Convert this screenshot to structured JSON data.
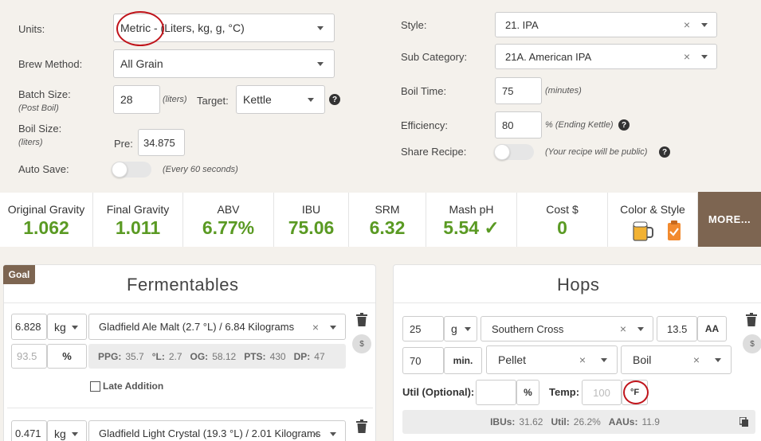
{
  "settings": {
    "units_label": "Units:",
    "units_value": "Metric - (Liters, kg, g, °C)",
    "brew_method_label": "Brew Method:",
    "brew_method_value": "All Grain",
    "batch_size_label": "Batch Size:",
    "batch_size_sub": "(Post Boil)",
    "batch_size_value": "28",
    "batch_size_unit": "(liters)",
    "target_label": "Target:",
    "target_value": "Kettle",
    "boil_size_label": "Boil Size:",
    "boil_size_sub": "(liters)",
    "pre_label": "Pre:",
    "pre_value": "34.875",
    "auto_save_label": "Auto Save:",
    "auto_save_note": "(Every 60 seconds)",
    "style_label": "Style:",
    "style_value": "21. IPA",
    "sub_category_label": "Sub Category:",
    "sub_category_value": "21A. American IPA",
    "boil_time_label": "Boil Time:",
    "boil_time_value": "75",
    "boil_time_unit": "(minutes)",
    "efficiency_label": "Efficiency:",
    "efficiency_value": "80",
    "efficiency_unit": "% (Ending Kettle)",
    "share_label": "Share Recipe:",
    "share_note": "(Your recipe will be public)",
    "help_glyph": "?"
  },
  "stats": [
    {
      "label": "Original Gravity",
      "value": "1.062"
    },
    {
      "label": "Final Gravity",
      "value": "1.011"
    },
    {
      "label": "ABV",
      "value": "6.77%"
    },
    {
      "label": "IBU",
      "value": "75.06"
    },
    {
      "label": "SRM",
      "value": "6.32"
    },
    {
      "label": "Mash pH",
      "value": "5.54 ✓"
    },
    {
      "label": "Cost $",
      "value": "0"
    },
    {
      "label": "Color & Style",
      "value": ""
    }
  ],
  "more_label": "MORE...",
  "fermentables": {
    "goal_badge": "Goal",
    "title": "Fermentables",
    "items": [
      {
        "amount": "6.828",
        "unit": "kg",
        "name": "Gladfield Ale Malt (2.7 °L) / 6.84 Kilograms",
        "pct": "93.5",
        "pct_symbol": "%",
        "info": [
          {
            "k": "PPG:",
            "v": "35.7"
          },
          {
            "k": "°L:",
            "v": "2.7"
          },
          {
            "k": "OG:",
            "v": "58.12"
          },
          {
            "k": "PTS:",
            "v": "430"
          },
          {
            "k": "DP:",
            "v": "47"
          }
        ],
        "late_addition": "Late Addition"
      },
      {
        "amount": "0.471",
        "unit": "kg",
        "name": "Gladfield Light Crystal (19.3 °L) / 2.01 Kilograms"
      }
    ]
  },
  "hops": {
    "title": "Hops",
    "amount": "25",
    "unit": "g",
    "variety": "Southern Cross",
    "aa_value": "13.5",
    "aa_label": "AA",
    "time": "70",
    "time_unit": "min.",
    "form": "Pellet",
    "use": "Boil",
    "util_label": "Util (Optional):",
    "util_value": "",
    "util_pct": "%",
    "temp_label": "Temp:",
    "temp_placeholder": "100",
    "temp_unit": "°F",
    "info": [
      {
        "k": "IBUs:",
        "v": "31.62"
      },
      {
        "k": "Util:",
        "v": "26.2%"
      },
      {
        "k": "AAUs:",
        "v": "11.9"
      }
    ]
  },
  "glyphs": {
    "clear": "×",
    "dollar": "$"
  },
  "colors": {
    "accent_green": "#5a9a23",
    "more_bg": "#7d6551",
    "goal_bg": "#7d6551",
    "annotation_red": "#c0141b"
  }
}
